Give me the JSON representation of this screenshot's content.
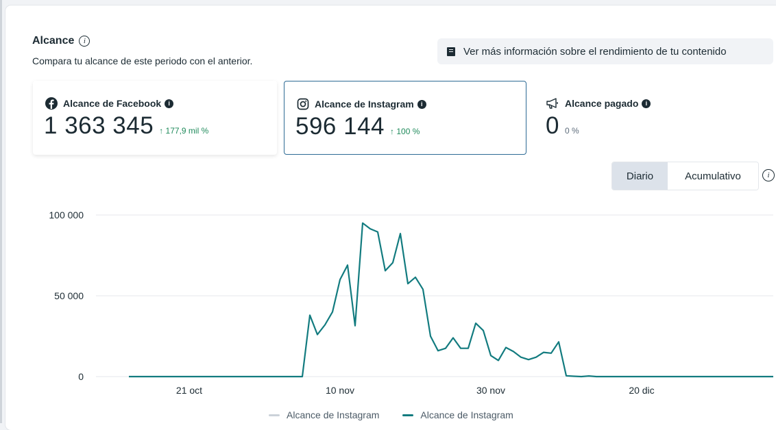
{
  "header": {
    "title": "Alcance",
    "subtitle": "Compara tu alcance de este periodo con el anterior.",
    "more_info_label": "Ver más información sobre el rendimiento de tu contenido"
  },
  "metrics": [
    {
      "label": "Alcance de Facebook",
      "value": "1 363 345",
      "change": "↑ 177,9 mil %",
      "icon": "facebook-icon"
    },
    {
      "label": "Alcance de Instagram",
      "value": "596 144",
      "change": "↑ 100 %",
      "icon": "instagram-icon"
    },
    {
      "label": "Alcance pagado",
      "value": "0",
      "change": "0 %",
      "icon": "megaphone-icon"
    }
  ],
  "toggle": {
    "daily_label": "Diario",
    "cumulative_label": "Acumulativo",
    "selected": "Diario"
  },
  "colors": {
    "series_current": "#127b7f",
    "series_previous": "#cbd2d9",
    "positive_change": "#1f8a5b",
    "selected_border": "#2d6a94"
  },
  "chart_data": {
    "type": "line",
    "x_tick_labels": [
      "21 oct",
      "10 nov",
      "30 nov",
      "20 dic"
    ],
    "y_tick_labels": [
      "0",
      "50 000",
      "100 000"
    ],
    "ylim": [
      0,
      100000
    ],
    "grid": true,
    "legend_position": "bottom",
    "series": [
      {
        "name": "Alcance de Instagram",
        "style": "previous",
        "values": []
      },
      {
        "name": "Alcance de Instagram",
        "style": "current",
        "dates": [
          "10-13",
          "11-05",
          "11-06",
          "11-07",
          "11-08",
          "11-09",
          "11-10",
          "11-11",
          "11-12",
          "11-13",
          "11-14",
          "11-15",
          "11-16",
          "11-17",
          "11-18",
          "11-19",
          "11-20",
          "11-21",
          "11-22",
          "11-23",
          "11-24",
          "11-25",
          "11-26",
          "11-27",
          "11-28",
          "11-29",
          "11-30",
          "12-01",
          "12-02",
          "12-03",
          "12-04",
          "12-05",
          "12-06",
          "12-07",
          "12-08",
          "12-09",
          "12-10",
          "12-11",
          "12-12",
          "12-13",
          "12-14",
          "12-15",
          "01-08"
        ],
        "values": [
          0,
          0,
          38000,
          26000,
          32000,
          40000,
          60000,
          69000,
          31500,
          95000,
          91500,
          89500,
          65500,
          70500,
          88500,
          57500,
          61500,
          54000,
          25000,
          16000,
          17500,
          24000,
          17500,
          17500,
          33000,
          28500,
          13000,
          10000,
          18000,
          15500,
          12000,
          10500,
          12000,
          15000,
          14500,
          21500,
          500,
          200,
          0,
          400,
          0,
          0,
          0
        ]
      }
    ]
  }
}
